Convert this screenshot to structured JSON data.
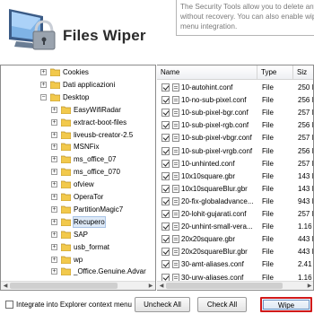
{
  "header": {
    "title": "Files Wiper",
    "info_lines": [
      "The Security Tools allow you to delete any fi",
      "without recovery. You can also enable wiping",
      "menu integration."
    ]
  },
  "tree": {
    "items": [
      {
        "label": "Cookies",
        "level": 3,
        "expander": "+"
      },
      {
        "label": "Dati applicazioni",
        "level": 3,
        "expander": "+"
      },
      {
        "label": "Desktop",
        "level": 3,
        "expander": "-"
      },
      {
        "label": "EasyWifiRadar",
        "level": 4,
        "expander": "+"
      },
      {
        "label": "extract-boot-files",
        "level": 4,
        "expander": "+"
      },
      {
        "label": "liveusb-creator-2.5",
        "level": 4,
        "expander": "+"
      },
      {
        "label": "MSNFix",
        "level": 4,
        "expander": "+"
      },
      {
        "label": "ms_office_07",
        "level": 4,
        "expander": "+"
      },
      {
        "label": "ms_office_070",
        "level": 4,
        "expander": "+"
      },
      {
        "label": "ofview",
        "level": 4,
        "expander": "+"
      },
      {
        "label": "OperaTor",
        "level": 4,
        "expander": "+"
      },
      {
        "label": "PartitionMagic7",
        "level": 4,
        "expander": "+"
      },
      {
        "label": "Recupero",
        "level": 4,
        "expander": "+",
        "selected": true
      },
      {
        "label": "SAP",
        "level": 4,
        "expander": "+"
      },
      {
        "label": "usb_format",
        "level": 4,
        "expander": "+"
      },
      {
        "label": "wp",
        "level": 4,
        "expander": "+"
      },
      {
        "label": "_Office.Genuine.Advar",
        "level": 4,
        "expander": "+"
      }
    ]
  },
  "list": {
    "columns": {
      "name": "Name",
      "type": "Type",
      "size": "Siz"
    },
    "rows": [
      {
        "name": "10-autohint.conf",
        "type": "File",
        "size": "250 I"
      },
      {
        "name": "10-no-sub-pixel.conf",
        "type": "File",
        "size": "256 I"
      },
      {
        "name": "10-sub-pixel-bgr.conf",
        "type": "File",
        "size": "257 I"
      },
      {
        "name": "10-sub-pixel-rgb.conf",
        "type": "File",
        "size": "256 I"
      },
      {
        "name": "10-sub-pixel-vbgr.conf",
        "type": "File",
        "size": "257 I"
      },
      {
        "name": "10-sub-pixel-vrgb.conf",
        "type": "File",
        "size": "256 I"
      },
      {
        "name": "10-unhinted.conf",
        "type": "File",
        "size": "257 I"
      },
      {
        "name": "10x10square.gbr",
        "type": "File",
        "size": "143 I"
      },
      {
        "name": "10x10squareBlur.gbr",
        "type": "File",
        "size": "143 I"
      },
      {
        "name": "20-fix-globaladvance...",
        "type": "File",
        "size": "943 I"
      },
      {
        "name": "20-lohit-gujarati.conf",
        "type": "File",
        "size": "257 I"
      },
      {
        "name": "20-unhint-small-vera...",
        "type": "File",
        "size": "1.16 I"
      },
      {
        "name": "20x20square.gbr",
        "type": "File",
        "size": "443 I"
      },
      {
        "name": "20x20squareBlur.gbr",
        "type": "File",
        "size": "443 I"
      },
      {
        "name": "30-amt-aliases.conf",
        "type": "File",
        "size": "2.41 I"
      },
      {
        "name": "30-urw-aliases.conf",
        "type": "File",
        "size": "1.16 I"
      }
    ]
  },
  "footer": {
    "integrate_label": "Integrate into Explorer context menu",
    "uncheck_all": "Uncheck All",
    "check_all": "Check All",
    "wipe": "Wipe"
  },
  "colors": {
    "folder": "#f2c94c",
    "wipe_border": "#d21a1a",
    "selection": "#dde9f7"
  }
}
